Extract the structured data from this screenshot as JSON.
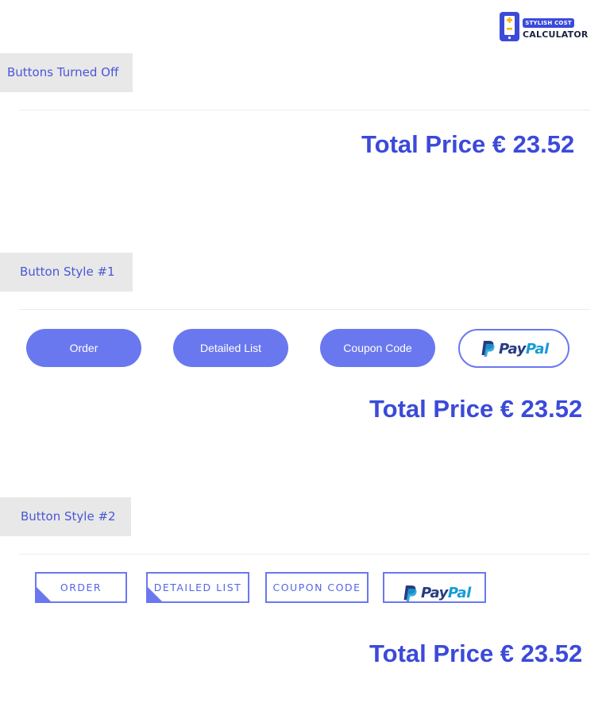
{
  "logo": {
    "tagline": "STYLISH COST",
    "name": "CALCULATOR"
  },
  "colors": {
    "accent": "#3b4ad9",
    "button": "#6a78ef",
    "paypal_dark": "#253b80",
    "paypal_light": "#179bd7"
  },
  "sections": [
    {
      "title": "Buttons Turned Off",
      "total_label": "Total Price € 23.52"
    },
    {
      "title": "Button Style #1",
      "buttons": {
        "order": "Order",
        "detailed_list": "Detailed List",
        "coupon_code": "Coupon Code"
      },
      "paypal": {
        "pay": "Pay",
        "pal": "Pal",
        "icon": "paypal-icon"
      },
      "total_label": "Total Price € 23.52"
    },
    {
      "title": "Button Style #2",
      "buttons": {
        "order": "ORDER",
        "detailed_list": "DETAILED LIST",
        "coupon_code": "COUPON CODE"
      },
      "paypal": {
        "pay": "Pay",
        "pal": "Pal",
        "icon": "paypal-icon"
      },
      "total_label": "Total Price € 23.52"
    }
  ]
}
